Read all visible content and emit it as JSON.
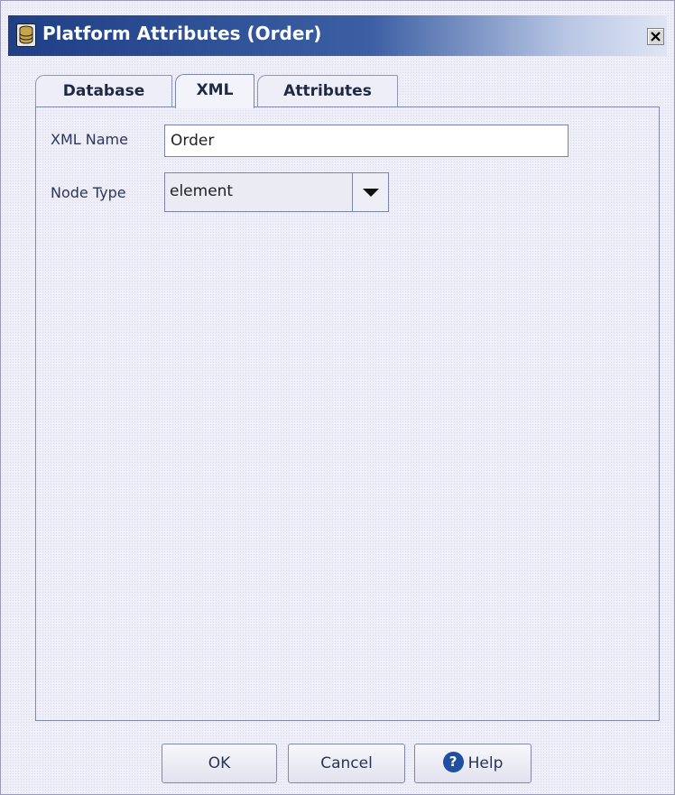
{
  "window": {
    "title": "Platform Attributes (Order)"
  },
  "tabs": [
    {
      "label": "Database",
      "active": false
    },
    {
      "label": "XML",
      "active": true
    },
    {
      "label": "Attributes",
      "active": false
    }
  ],
  "form": {
    "xml_name": {
      "label": "XML Name",
      "value": "Order"
    },
    "node_type": {
      "label": "Node Type",
      "value": "element"
    }
  },
  "buttons": {
    "ok": "OK",
    "cancel": "Cancel",
    "help": "Help"
  },
  "icons": {
    "title": "database-icon",
    "close": "close-icon",
    "dropdown": "chevron-down-icon",
    "help": "question-icon"
  },
  "colors": {
    "title_bar": "#1f3f86",
    "help_icon": "#1e4fa2"
  }
}
